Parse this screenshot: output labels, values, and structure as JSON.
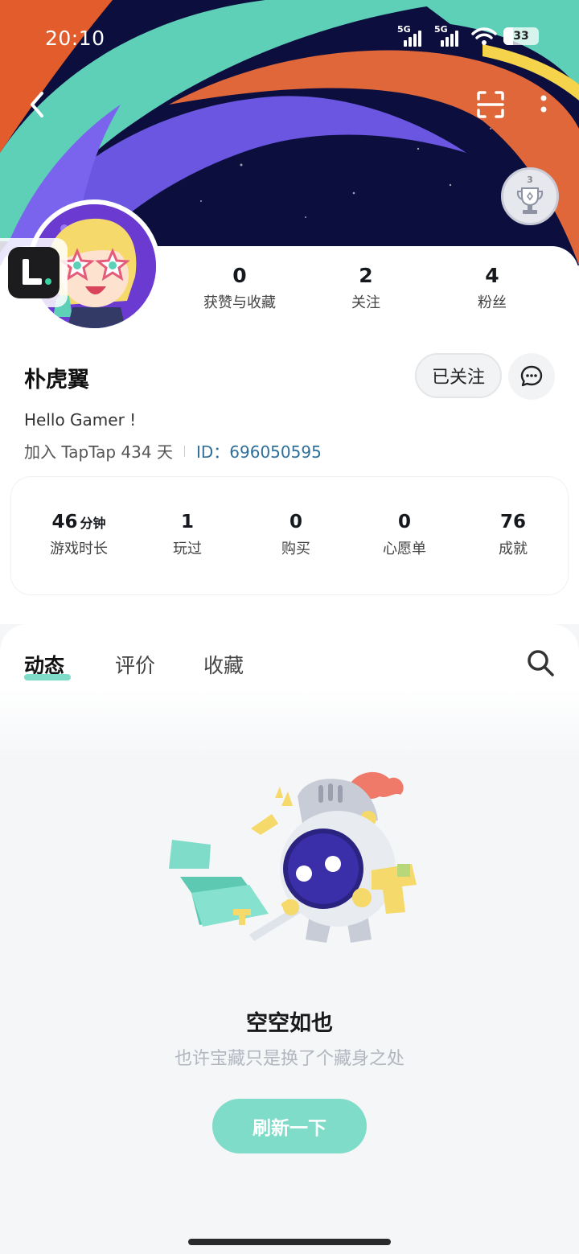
{
  "status_bar": {
    "time": "20:10",
    "signal1_label": "5G",
    "signal2_label": "5G",
    "battery": "33"
  },
  "header": {
    "trophy_level": "3",
    "trophy_icon": "trophy-icon"
  },
  "profile": {
    "name": "朴虎翼",
    "follow_label": "已关注",
    "bio": "Hello Gamer !",
    "joined": "加入 TapTap 434 天",
    "id_text": "ID：696050595"
  },
  "social_stats": [
    {
      "value": "0",
      "label": "获赞与收藏"
    },
    {
      "value": "2",
      "label": "关注"
    },
    {
      "value": "4",
      "label": "粉丝"
    }
  ],
  "game_stats": [
    {
      "value": "46",
      "unit": "分钟",
      "label": "游戏时长"
    },
    {
      "value": "1",
      "unit": "",
      "label": "玩过"
    },
    {
      "value": "0",
      "unit": "",
      "label": "购买"
    },
    {
      "value": "0",
      "unit": "",
      "label": "心愿单"
    },
    {
      "value": "76",
      "unit": "",
      "label": "成就"
    }
  ],
  "tabs": [
    {
      "label": "动态",
      "active": true
    },
    {
      "label": "评价",
      "active": false
    },
    {
      "label": "收藏",
      "active": false
    }
  ],
  "empty_state": {
    "title": "空空如也",
    "subtitle": "也许宝藏只是换了个藏身之处",
    "refresh_label": "刷新一下"
  },
  "colors": {
    "accent": "#7fdcc8",
    "id_link": "#2f6f9a",
    "banner_bg": "#0c0f3e"
  }
}
